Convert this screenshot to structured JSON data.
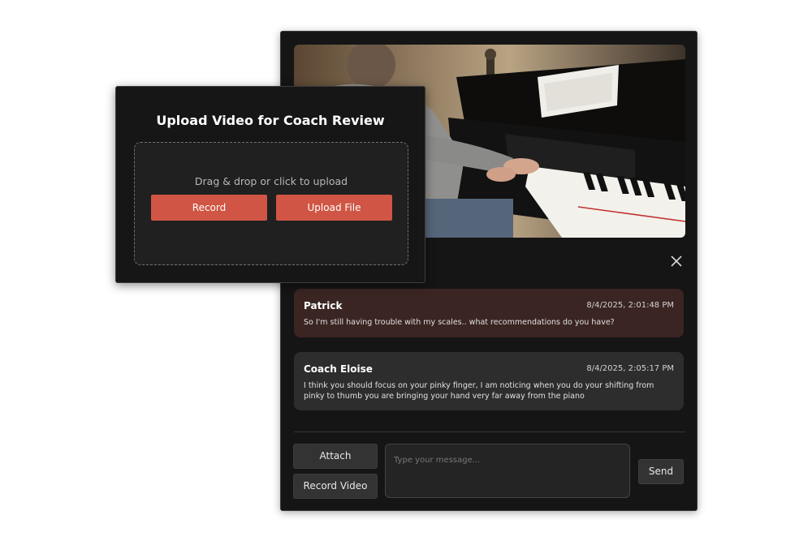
{
  "video": {
    "content": "piano-performance-video"
  },
  "messages": [
    {
      "author": "Patrick",
      "timestamp": "8/4/2025, 2:01:48 PM",
      "text": "So I'm still having trouble with my scales.. what recommendations do you have?"
    },
    {
      "author": "Coach Eloise",
      "timestamp": "8/4/2025, 2:05:17 PM",
      "text": "I think you should focus on your pinky finger, I am noticing when you do your shifting from pinky to thumb you are bringing your hand very far away from the piano"
    }
  ],
  "composer": {
    "attach_label": "Attach",
    "record_video_label": "Record Video",
    "placeholder": "Type your message...",
    "send_label": "Send"
  },
  "upload_modal": {
    "title": "Upload Video for Coach Review",
    "dropzone_text": "Drag & drop or click to upload",
    "record_label": "Record",
    "upload_file_label": "Upload File"
  },
  "icons": {
    "close": "close-icon"
  },
  "colors": {
    "accent": "#d05544",
    "panel_bg": "#151515",
    "patrick_bubble": "#3a2522",
    "coach_bubble": "#2d2d2e"
  }
}
